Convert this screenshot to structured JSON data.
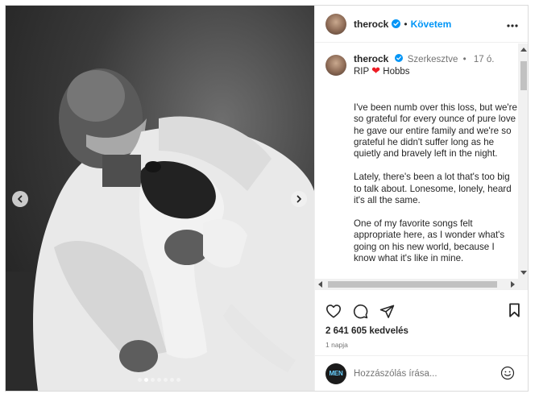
{
  "post": {
    "username": "therock",
    "follow_label": "Követem",
    "separator": "•",
    "more_icon": "more-horizontal-icon"
  },
  "caption": {
    "username": "therock",
    "edited_label": "Szerkesztve",
    "separator": "•",
    "age": "17 ó.",
    "title_rip": "RIP",
    "title_name": "Hobbs",
    "paragraphs": [
      "I've been numb over this loss, but we're so grateful for every ounce of pure love he gave our entire family and we're so grateful he didn't suffer long as he quietly and bravely left in the night.",
      "Lately, there's been a lot that's too big to talk about. Lonesome, lonely, heard it's all the same.",
      "One of my favorite songs felt appropriate here, as I wonder what's going on his new world, because I know what it's like in mine."
    ]
  },
  "stats": {
    "likes": "2 641 605 kedvelés",
    "date": "1 napja"
  },
  "comment": {
    "placeholder": "Hozzászólás írása...",
    "avatar_text": "MEN"
  },
  "carousel": {
    "dots": 7,
    "active_index": 1
  },
  "colors": {
    "accent": "#0095f6",
    "heart": "#ed1c24",
    "verified": "#0095f6"
  }
}
